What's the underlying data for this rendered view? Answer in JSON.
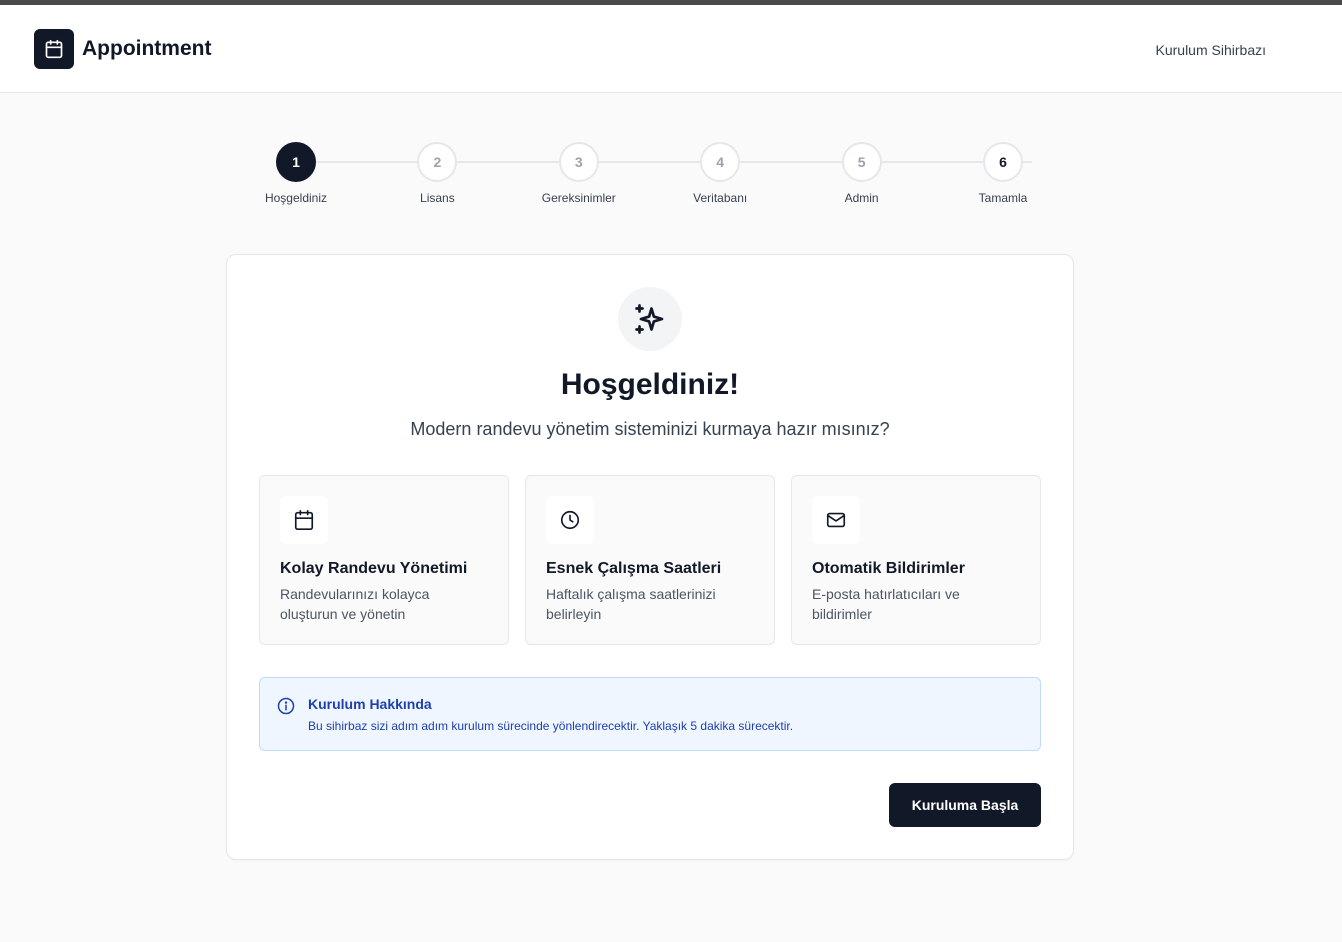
{
  "header": {
    "app_title": "Appointment",
    "right_label": "Kurulum Sihirbazı"
  },
  "stepper": {
    "active_step": 1,
    "steps": [
      {
        "number": "1",
        "label": "Hoşgeldiniz"
      },
      {
        "number": "2",
        "label": "Lisans"
      },
      {
        "number": "3",
        "label": "Gereksinimler"
      },
      {
        "number": "4",
        "label": "Veritabanı"
      },
      {
        "number": "5",
        "label": "Admin"
      },
      {
        "number": "6",
        "label": "Tamamla"
      }
    ]
  },
  "main": {
    "hero_icon": "sparkles-icon",
    "title": "Hoşgeldiniz!",
    "subtitle": "Modern randevu yönetim sisteminizi kurmaya hazır mısınız?",
    "features": [
      {
        "icon": "calendar-icon",
        "title": "Kolay Randevu Yönetimi",
        "description": "Randevularınızı kolayca oluşturun ve yönetin"
      },
      {
        "icon": "clock-icon",
        "title": "Esnek Çalışma Saatleri",
        "description": "Haftalık çalışma saatlerinizi belirleyin"
      },
      {
        "icon": "mail-icon",
        "title": "Otomatik Bildirimler",
        "description": "E-posta hatırlatıcıları ve bildirimler"
      }
    ],
    "info": {
      "icon": "info-icon",
      "title": "Kurulum Hakkında",
      "text": "Bu sihirbaz sizi adım adım kurulum sürecinde yönlendirecektir. Yaklaşık 5 dakika sürecektir."
    },
    "start_button": "Kuruluma Başla"
  },
  "colors": {
    "primary": "#111827",
    "info_bg": "#eff6ff",
    "info_border": "#bfdbfe",
    "info_text": "#1e40af",
    "inactive_step": "#9ca3af"
  }
}
